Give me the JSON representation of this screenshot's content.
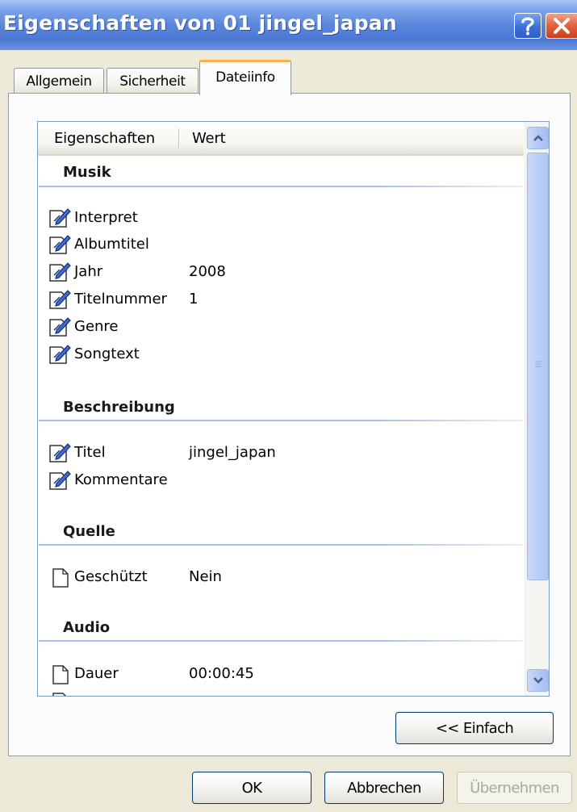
{
  "window": {
    "title": "Eigenschaften von 01 jingel_japan",
    "help_label": "?",
    "close_label": "×"
  },
  "tabs": [
    {
      "label": "Allgemein",
      "selected": false
    },
    {
      "label": "Sicherheit",
      "selected": false
    },
    {
      "label": "Dateiinfo",
      "selected": true
    }
  ],
  "list": {
    "columns": [
      "Eigenschaften",
      "Wert"
    ],
    "groups": [
      {
        "title": "Musik",
        "rows": [
          {
            "name": "Interpret",
            "value": "",
            "icon": "edit-icon"
          },
          {
            "name": "Albumtitel",
            "value": "",
            "icon": "edit-icon"
          },
          {
            "name": "Jahr",
            "value": "2008",
            "icon": "edit-icon"
          },
          {
            "name": "Titelnummer",
            "value": "1",
            "icon": "edit-icon"
          },
          {
            "name": "Genre",
            "value": "",
            "icon": "edit-icon"
          },
          {
            "name": "Songtext",
            "value": "",
            "icon": "edit-icon"
          }
        ]
      },
      {
        "title": "Beschreibung",
        "rows": [
          {
            "name": "Titel",
            "value": "jingel_japan",
            "icon": "edit-icon"
          },
          {
            "name": "Kommentare",
            "value": "",
            "icon": "edit-icon"
          }
        ]
      },
      {
        "title": "Quelle",
        "rows": [
          {
            "name": "Geschützt",
            "value": "Nein",
            "icon": "document-icon"
          }
        ]
      },
      {
        "title": "Audio",
        "rows": [
          {
            "name": "Dauer",
            "value": "00:00:45",
            "icon": "document-icon"
          }
        ]
      }
    ]
  },
  "buttons": {
    "einfach": "<< Einfach",
    "ok": "OK",
    "abbrechen": "Abbrechen",
    "uebernehmen": "Übernehmen"
  },
  "colors": {
    "titlebar": "#4c78d4",
    "group_text": "#1a1a1a",
    "group_line": "#a8c1e4",
    "active_tab_accent": "#f6b24a"
  }
}
